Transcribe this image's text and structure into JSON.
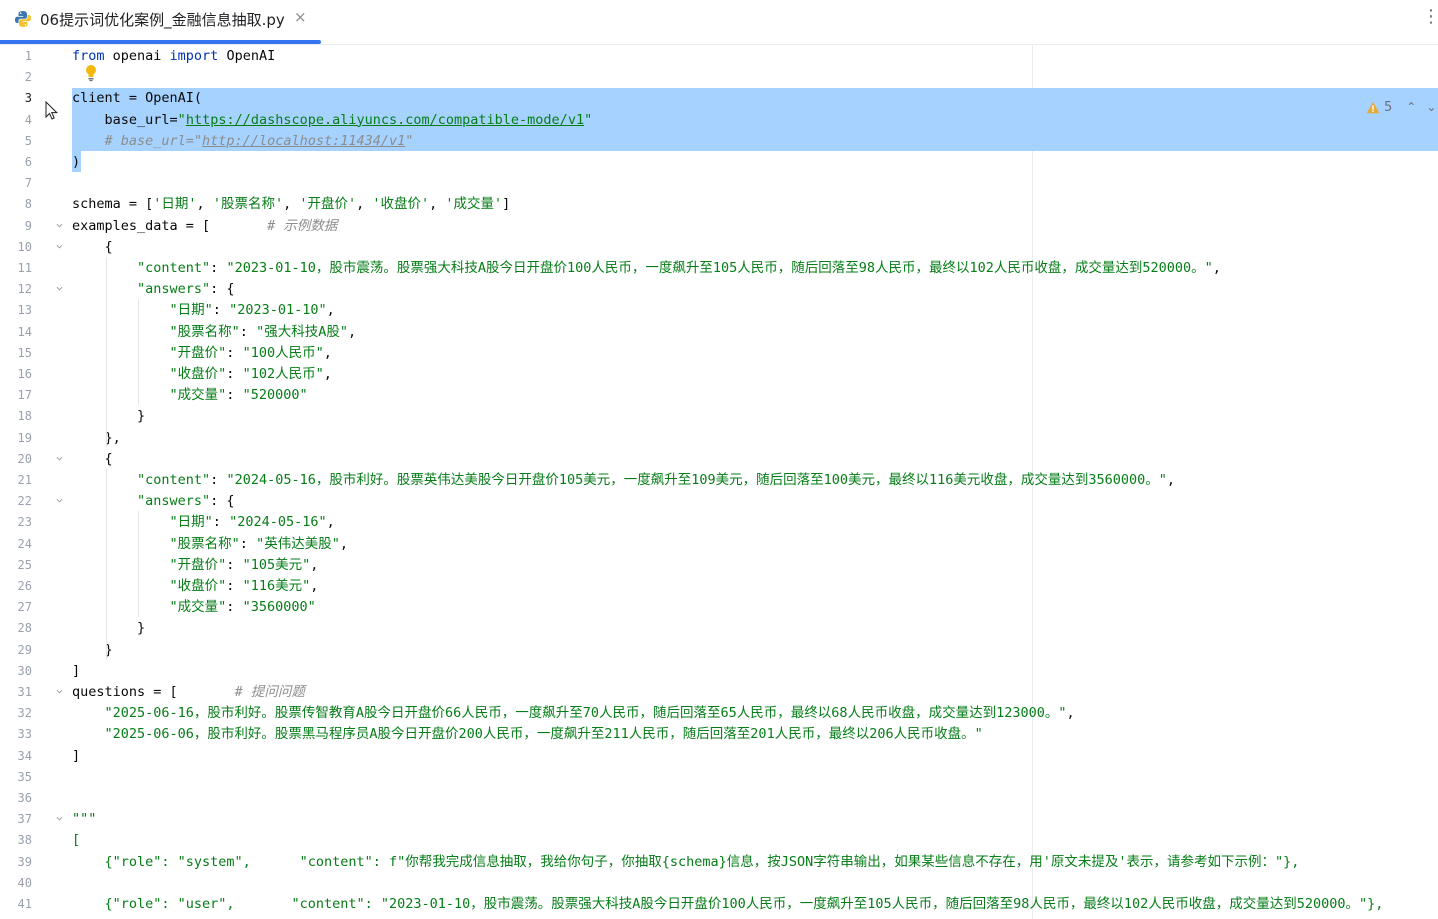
{
  "tab": {
    "title": "06提示词优化案例_金融信息抽取.py",
    "close": "×",
    "menu": "⋮"
  },
  "inspection": {
    "warnings": "5",
    "up": "⌃",
    "down": "⌄"
  },
  "colors": {
    "keyword": "#0033b3",
    "string": "#067d17",
    "comment": "#8c8c8c",
    "selection": "#a6d2ff",
    "accent": "#3574f0"
  },
  "editor": {
    "lines": [
      {
        "n": "1",
        "t": [
          [
            "kw",
            "from"
          ],
          [
            "p",
            " openai "
          ],
          [
            "kw",
            "import"
          ],
          [
            "p",
            " OpenAI"
          ]
        ]
      },
      {
        "n": "2",
        "t": []
      },
      {
        "n": "3",
        "t": [
          [
            "p",
            "client = OpenAI("
          ]
        ]
      },
      {
        "n": "4",
        "t": [
          [
            "p",
            "    base_url="
          ],
          [
            "str",
            "\""
          ],
          [
            "url",
            "https://dashscope.aliyuncs.com/compatible-mode/v1"
          ],
          [
            "str",
            "\""
          ]
        ]
      },
      {
        "n": "5",
        "t": [
          [
            "cm",
            "    # base_url=\""
          ],
          [
            "cmurl",
            "http://localhost:11434/v1"
          ],
          [
            "cm",
            "\""
          ]
        ]
      },
      {
        "n": "6",
        "t": [
          [
            "p",
            ")"
          ]
        ]
      },
      {
        "n": "7",
        "t": []
      },
      {
        "n": "8",
        "t": [
          [
            "p",
            "schema = ["
          ],
          [
            "str",
            "'日期'"
          ],
          [
            "p",
            ", "
          ],
          [
            "str",
            "'股票名称'"
          ],
          [
            "p",
            ", "
          ],
          [
            "str",
            "'开盘价'"
          ],
          [
            "p",
            ", "
          ],
          [
            "str",
            "'收盘价'"
          ],
          [
            "p",
            ", "
          ],
          [
            "str",
            "'成交量'"
          ],
          [
            "p",
            "]"
          ]
        ]
      },
      {
        "n": "9",
        "t": [
          [
            "p",
            "examples_data = [       "
          ],
          [
            "cm",
            "# 示例数据"
          ]
        ]
      },
      {
        "n": "10",
        "t": [
          [
            "p",
            "    {"
          ]
        ]
      },
      {
        "n": "11",
        "t": [
          [
            "str",
            "        \"content\""
          ],
          [
            "p",
            ": "
          ],
          [
            "str",
            "\"2023-01-10，股市震荡。股票强大科技A股今日开盘价100人民币，一度飙升至105人民币，随后回落至98人民币，最终以102人民币收盘，成交量达到520000。\""
          ],
          [
            "p",
            ","
          ]
        ]
      },
      {
        "n": "12",
        "t": [
          [
            "str",
            "        \"answers\""
          ],
          [
            "p",
            ": {"
          ]
        ]
      },
      {
        "n": "13",
        "t": [
          [
            "str",
            "            \"日期\""
          ],
          [
            "p",
            ": "
          ],
          [
            "str",
            "\"2023-01-10\""
          ],
          [
            "p",
            ","
          ]
        ]
      },
      {
        "n": "14",
        "t": [
          [
            "str",
            "            \"股票名称\""
          ],
          [
            "p",
            ": "
          ],
          [
            "str",
            "\"强大科技A股\""
          ],
          [
            "p",
            ","
          ]
        ]
      },
      {
        "n": "15",
        "t": [
          [
            "str",
            "            \"开盘价\""
          ],
          [
            "p",
            ": "
          ],
          [
            "str",
            "\"100人民币\""
          ],
          [
            "p",
            ","
          ]
        ]
      },
      {
        "n": "16",
        "t": [
          [
            "str",
            "            \"收盘价\""
          ],
          [
            "p",
            ": "
          ],
          [
            "str",
            "\"102人民币\""
          ],
          [
            "p",
            ","
          ]
        ]
      },
      {
        "n": "17",
        "t": [
          [
            "str",
            "            \"成交量\""
          ],
          [
            "p",
            ": "
          ],
          [
            "str",
            "\"520000\""
          ]
        ]
      },
      {
        "n": "18",
        "t": [
          [
            "p",
            "        }"
          ]
        ]
      },
      {
        "n": "19",
        "t": [
          [
            "p",
            "    },"
          ]
        ]
      },
      {
        "n": "20",
        "t": [
          [
            "p",
            "    {"
          ]
        ]
      },
      {
        "n": "21",
        "t": [
          [
            "str",
            "        \"content\""
          ],
          [
            "p",
            ": "
          ],
          [
            "str",
            "\"2024-05-16，股市利好。股票英伟达美股今日开盘价105美元，一度飙升至109美元，随后回落至100美元，最终以116美元收盘，成交量达到3560000。\""
          ],
          [
            "p",
            ","
          ]
        ]
      },
      {
        "n": "22",
        "t": [
          [
            "str",
            "        \"answers\""
          ],
          [
            "p",
            ": {"
          ]
        ]
      },
      {
        "n": "23",
        "t": [
          [
            "str",
            "            \"日期\""
          ],
          [
            "p",
            ": "
          ],
          [
            "str",
            "\"2024-05-16\""
          ],
          [
            "p",
            ","
          ]
        ]
      },
      {
        "n": "24",
        "t": [
          [
            "str",
            "            \"股票名称\""
          ],
          [
            "p",
            ": "
          ],
          [
            "str",
            "\"英伟达美股\""
          ],
          [
            "p",
            ","
          ]
        ]
      },
      {
        "n": "25",
        "t": [
          [
            "str",
            "            \"开盘价\""
          ],
          [
            "p",
            ": "
          ],
          [
            "str",
            "\"105美元\""
          ],
          [
            "p",
            ","
          ]
        ]
      },
      {
        "n": "26",
        "t": [
          [
            "str",
            "            \"收盘价\""
          ],
          [
            "p",
            ": "
          ],
          [
            "str",
            "\"116美元\""
          ],
          [
            "p",
            ","
          ]
        ]
      },
      {
        "n": "27",
        "t": [
          [
            "str",
            "            \"成交量\""
          ],
          [
            "p",
            ": "
          ],
          [
            "str",
            "\"3560000\""
          ]
        ]
      },
      {
        "n": "28",
        "t": [
          [
            "p",
            "        }"
          ]
        ]
      },
      {
        "n": "29",
        "t": [
          [
            "p",
            "    }"
          ]
        ]
      },
      {
        "n": "30",
        "t": [
          [
            "p",
            "]"
          ]
        ]
      },
      {
        "n": "31",
        "t": [
          [
            "p",
            "questions = [       "
          ],
          [
            "cm",
            "# 提问问题"
          ]
        ]
      },
      {
        "n": "32",
        "t": [
          [
            "str",
            "    \"2025-06-16，股市利好。股票传智教育A股今日开盘价66人民币，一度飙升至70人民币，随后回落至65人民币，最终以68人民币收盘，成交量达到123000。\""
          ],
          [
            "p",
            ","
          ]
        ]
      },
      {
        "n": "33",
        "t": [
          [
            "str",
            "    \"2025-06-06，股市利好。股票黑马程序员A股今日开盘价200人民币，一度飙升至211人民币，随后回落至201人民币，最终以206人民币收盘。\""
          ]
        ]
      },
      {
        "n": "34",
        "t": [
          [
            "p",
            "]"
          ]
        ]
      },
      {
        "n": "35",
        "t": []
      },
      {
        "n": "36",
        "t": []
      },
      {
        "n": "37",
        "t": [
          [
            "str",
            "\"\"\""
          ]
        ]
      },
      {
        "n": "38",
        "t": [
          [
            "str",
            "["
          ]
        ]
      },
      {
        "n": "39",
        "t": [
          [
            "str",
            "    {\"role\": \"system\",      \"content\": f\"你帮我完成信息抽取，我给你句子，你抽取{schema}信息，按JSON字符串输出，如果某些信息不存在，用'原文未提及'表示，请参考如下示例：\"},"
          ]
        ]
      },
      {
        "n": "40",
        "t": []
      },
      {
        "n": "41",
        "t": [
          [
            "str",
            "    {\"role\": \"user\",       \"content\": \"2023-01-10，股市震荡。股票强大科技A股今日开盘价100人民币，一度飙升至105人民币，随后回落至98人民币，最终以102人民币收盘，成交量达到520000。\"},"
          ]
        ]
      }
    ]
  }
}
